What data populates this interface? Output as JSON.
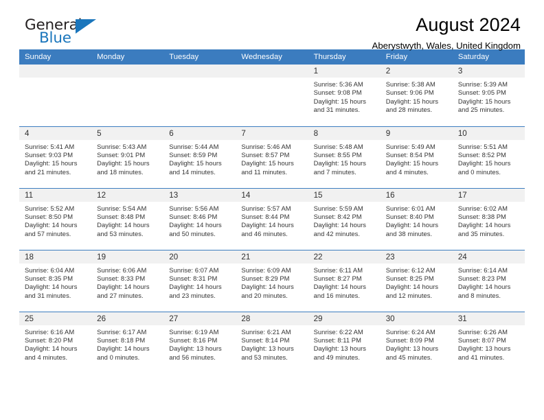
{
  "logo": {
    "word_top": "General",
    "word_bottom": "Blue",
    "triangle_icon": "triangle-icon",
    "accent_color": "#1b76bc"
  },
  "header": {
    "title": "August 2024",
    "subtitle": "Aberystwyth, Wales, United Kingdom"
  },
  "theme": {
    "header_blue": "#3b7cbf",
    "daynum_gray": "#f1f1f1",
    "text": "#333333"
  },
  "calendar": {
    "weekday_headers": [
      "Sunday",
      "Monday",
      "Tuesday",
      "Wednesday",
      "Thursday",
      "Friday",
      "Saturday"
    ],
    "labels": {
      "sunrise": "Sunrise:",
      "sunset": "Sunset:",
      "daylight": "Daylight:"
    },
    "weeks": [
      [
        {
          "day": "",
          "empty": true
        },
        {
          "day": "",
          "empty": true
        },
        {
          "day": "",
          "empty": true
        },
        {
          "day": "",
          "empty": true
        },
        {
          "day": "1",
          "sunrise": "Sunrise: 5:36 AM",
          "sunset": "Sunset: 9:08 PM",
          "daylight": "Daylight: 15 hours and 31 minutes."
        },
        {
          "day": "2",
          "sunrise": "Sunrise: 5:38 AM",
          "sunset": "Sunset: 9:06 PM",
          "daylight": "Daylight: 15 hours and 28 minutes."
        },
        {
          "day": "3",
          "sunrise": "Sunrise: 5:39 AM",
          "sunset": "Sunset: 9:05 PM",
          "daylight": "Daylight: 15 hours and 25 minutes."
        }
      ],
      [
        {
          "day": "4",
          "sunrise": "Sunrise: 5:41 AM",
          "sunset": "Sunset: 9:03 PM",
          "daylight": "Daylight: 15 hours and 21 minutes."
        },
        {
          "day": "5",
          "sunrise": "Sunrise: 5:43 AM",
          "sunset": "Sunset: 9:01 PM",
          "daylight": "Daylight: 15 hours and 18 minutes."
        },
        {
          "day": "6",
          "sunrise": "Sunrise: 5:44 AM",
          "sunset": "Sunset: 8:59 PM",
          "daylight": "Daylight: 15 hours and 14 minutes."
        },
        {
          "day": "7",
          "sunrise": "Sunrise: 5:46 AM",
          "sunset": "Sunset: 8:57 PM",
          "daylight": "Daylight: 15 hours and 11 minutes."
        },
        {
          "day": "8",
          "sunrise": "Sunrise: 5:48 AM",
          "sunset": "Sunset: 8:55 PM",
          "daylight": "Daylight: 15 hours and 7 minutes."
        },
        {
          "day": "9",
          "sunrise": "Sunrise: 5:49 AM",
          "sunset": "Sunset: 8:54 PM",
          "daylight": "Daylight: 15 hours and 4 minutes."
        },
        {
          "day": "10",
          "sunrise": "Sunrise: 5:51 AM",
          "sunset": "Sunset: 8:52 PM",
          "daylight": "Daylight: 15 hours and 0 minutes."
        }
      ],
      [
        {
          "day": "11",
          "sunrise": "Sunrise: 5:52 AM",
          "sunset": "Sunset: 8:50 PM",
          "daylight": "Daylight: 14 hours and 57 minutes."
        },
        {
          "day": "12",
          "sunrise": "Sunrise: 5:54 AM",
          "sunset": "Sunset: 8:48 PM",
          "daylight": "Daylight: 14 hours and 53 minutes."
        },
        {
          "day": "13",
          "sunrise": "Sunrise: 5:56 AM",
          "sunset": "Sunset: 8:46 PM",
          "daylight": "Daylight: 14 hours and 50 minutes."
        },
        {
          "day": "14",
          "sunrise": "Sunrise: 5:57 AM",
          "sunset": "Sunset: 8:44 PM",
          "daylight": "Daylight: 14 hours and 46 minutes."
        },
        {
          "day": "15",
          "sunrise": "Sunrise: 5:59 AM",
          "sunset": "Sunset: 8:42 PM",
          "daylight": "Daylight: 14 hours and 42 minutes."
        },
        {
          "day": "16",
          "sunrise": "Sunrise: 6:01 AM",
          "sunset": "Sunset: 8:40 PM",
          "daylight": "Daylight: 14 hours and 38 minutes."
        },
        {
          "day": "17",
          "sunrise": "Sunrise: 6:02 AM",
          "sunset": "Sunset: 8:38 PM",
          "daylight": "Daylight: 14 hours and 35 minutes."
        }
      ],
      [
        {
          "day": "18",
          "sunrise": "Sunrise: 6:04 AM",
          "sunset": "Sunset: 8:35 PM",
          "daylight": "Daylight: 14 hours and 31 minutes."
        },
        {
          "day": "19",
          "sunrise": "Sunrise: 6:06 AM",
          "sunset": "Sunset: 8:33 PM",
          "daylight": "Daylight: 14 hours and 27 minutes."
        },
        {
          "day": "20",
          "sunrise": "Sunrise: 6:07 AM",
          "sunset": "Sunset: 8:31 PM",
          "daylight": "Daylight: 14 hours and 23 minutes."
        },
        {
          "day": "21",
          "sunrise": "Sunrise: 6:09 AM",
          "sunset": "Sunset: 8:29 PM",
          "daylight": "Daylight: 14 hours and 20 minutes."
        },
        {
          "day": "22",
          "sunrise": "Sunrise: 6:11 AM",
          "sunset": "Sunset: 8:27 PM",
          "daylight": "Daylight: 14 hours and 16 minutes."
        },
        {
          "day": "23",
          "sunrise": "Sunrise: 6:12 AM",
          "sunset": "Sunset: 8:25 PM",
          "daylight": "Daylight: 14 hours and 12 minutes."
        },
        {
          "day": "24",
          "sunrise": "Sunrise: 6:14 AM",
          "sunset": "Sunset: 8:23 PM",
          "daylight": "Daylight: 14 hours and 8 minutes."
        }
      ],
      [
        {
          "day": "25",
          "sunrise": "Sunrise: 6:16 AM",
          "sunset": "Sunset: 8:20 PM",
          "daylight": "Daylight: 14 hours and 4 minutes."
        },
        {
          "day": "26",
          "sunrise": "Sunrise: 6:17 AM",
          "sunset": "Sunset: 8:18 PM",
          "daylight": "Daylight: 14 hours and 0 minutes."
        },
        {
          "day": "27",
          "sunrise": "Sunrise: 6:19 AM",
          "sunset": "Sunset: 8:16 PM",
          "daylight": "Daylight: 13 hours and 56 minutes."
        },
        {
          "day": "28",
          "sunrise": "Sunrise: 6:21 AM",
          "sunset": "Sunset: 8:14 PM",
          "daylight": "Daylight: 13 hours and 53 minutes."
        },
        {
          "day": "29",
          "sunrise": "Sunrise: 6:22 AM",
          "sunset": "Sunset: 8:11 PM",
          "daylight": "Daylight: 13 hours and 49 minutes."
        },
        {
          "day": "30",
          "sunrise": "Sunrise: 6:24 AM",
          "sunset": "Sunset: 8:09 PM",
          "daylight": "Daylight: 13 hours and 45 minutes."
        },
        {
          "day": "31",
          "sunrise": "Sunrise: 6:26 AM",
          "sunset": "Sunset: 8:07 PM",
          "daylight": "Daylight: 13 hours and 41 minutes."
        }
      ]
    ]
  }
}
